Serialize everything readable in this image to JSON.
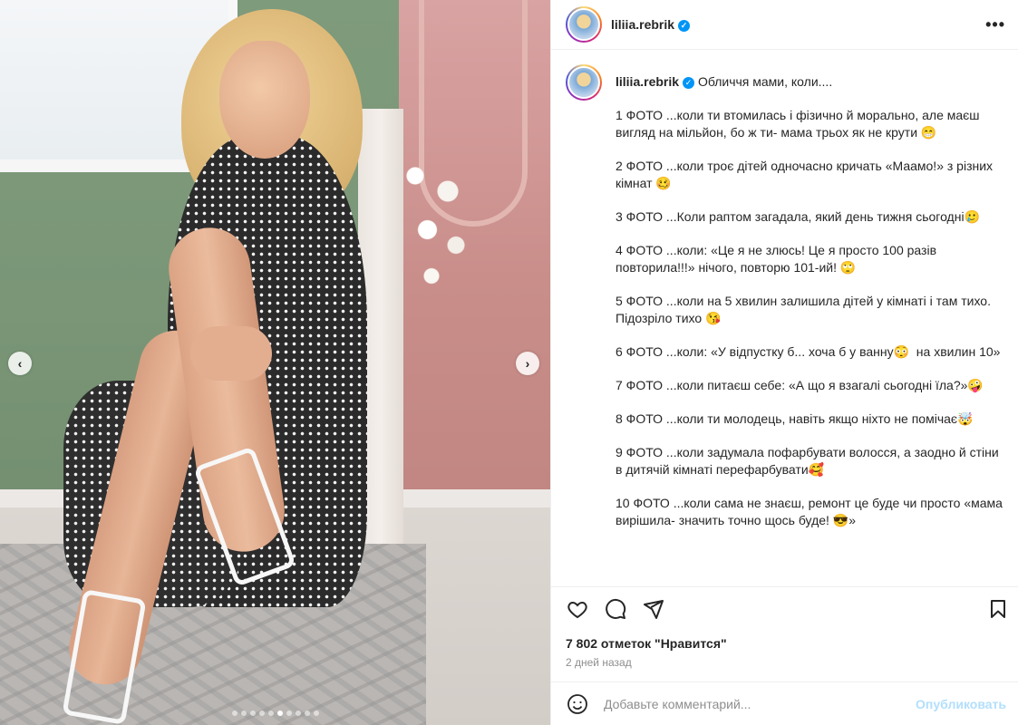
{
  "post": {
    "username": "liliia.rebrik",
    "verified_mark": "✓",
    "more_label": "•••",
    "carousel": {
      "slide_count": 10,
      "active_slide": 6,
      "prev_label": "‹",
      "next_label": "›"
    }
  },
  "caption": {
    "username": "liliia.rebrik",
    "first_line": "Обличчя мами, коли....",
    "lines": [
      "1 ФОТО ...коли ти втомилась і фізично й морально, але маєш вигляд на мільйон, бо ж ти- мама трьох як не крути 😁",
      "2 ФОТО ...коли троє дітей одночасно кричать «Маамо!» з різних кімнат 🥴",
      "3 ФОТО ...Коли раптом загадала, який день тижня сьогодні🥲",
      "4 ФОТО ...коли: «Це я не злюсь! Це я просто 100 разів повторила!!!» нічого, повторю 101-ий! 🙄",
      "5 ФОТО ...коли на 5 хвилин залишила дітей у кімнаті і там тихо.\nПідозріло тихо 😘",
      "6 ФОТО ...коли: «У відпустку б... хоча б у ванну😳  на хвилин 10»",
      "7 ФОТО ...коли питаєш себе: «А що я взагалі сьогодні їла?»🤪",
      "8 ФОТО ...коли ти молодець, навіть якщо ніхто не помічає🤯",
      "9 ФОТО ...коли задумала пофарбувати волосся, а заодно й стіни в дитячій кімнаті перефарбувати🥰",
      "10 ФОТО ...коли сама не знаєш, ремонт це буде чи просто «мама вирішила- значить точно щось буде! 😎»"
    ]
  },
  "icons": {
    "like": "heart-icon",
    "comment": "comment-icon",
    "share": "share-icon",
    "save": "bookmark-icon",
    "emoji": "emoji-icon"
  },
  "stats": {
    "likes": "7 802 отметок \"Нравится\"",
    "date": "2 дней назад"
  },
  "comment": {
    "placeholder": "Добавьте комментарий...",
    "post_label": "Опубликовать"
  },
  "colors": {
    "accent": "#0095f6",
    "post_disabled": "#b2dffc",
    "muted": "#8e8e8e"
  }
}
